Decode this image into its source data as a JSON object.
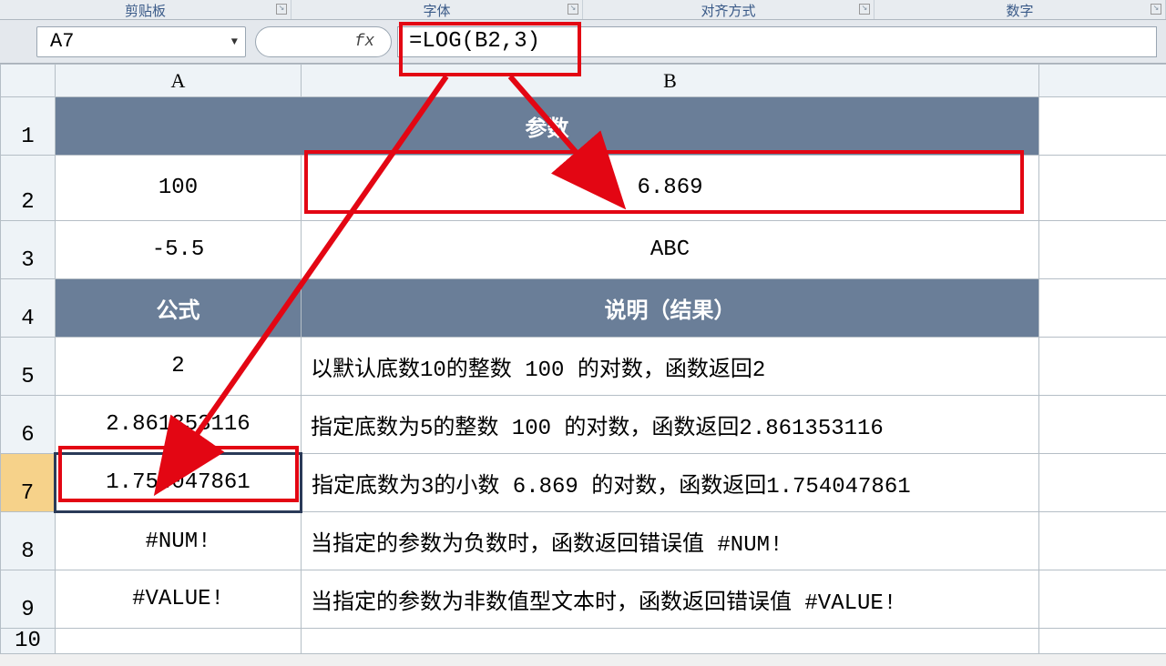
{
  "ribbon": {
    "groups": [
      "剪贴板",
      "字体",
      "对齐方式",
      "数字"
    ],
    "fx_label": "fx"
  },
  "name_box": "A7",
  "formula": "=LOG(B2,3)",
  "columns": {
    "A": "A",
    "B": "B"
  },
  "rows": {
    "1": {
      "merged_header": "参数"
    },
    "2": {
      "A": "100",
      "B": "6.869"
    },
    "3": {
      "A": "-5.5",
      "B": "ABC"
    },
    "4": {
      "A_header": "公式",
      "B_header": "说明（结果）"
    },
    "5": {
      "A": "2",
      "B": "以默认底数10的整数 100 的对数，函数返回2"
    },
    "6": {
      "A": "2.861353116",
      "B": "指定底数为5的整数 100 的对数，函数返回2.861353116"
    },
    "7": {
      "A": "1.754047861",
      "B": "指定底数为3的小数 6.869 的对数，函数返回1.754047861"
    },
    "8": {
      "A": "#NUM!",
      "B": "当指定的参数为负数时，函数返回错误值 #NUM!"
    },
    "9": {
      "A": "#VALUE!",
      "B": "当指定的参数为非数值型文本时，函数返回错误值 #VALUE!"
    },
    "10": {
      "A": "",
      "B": ""
    }
  },
  "annotation_color": "#e30613"
}
